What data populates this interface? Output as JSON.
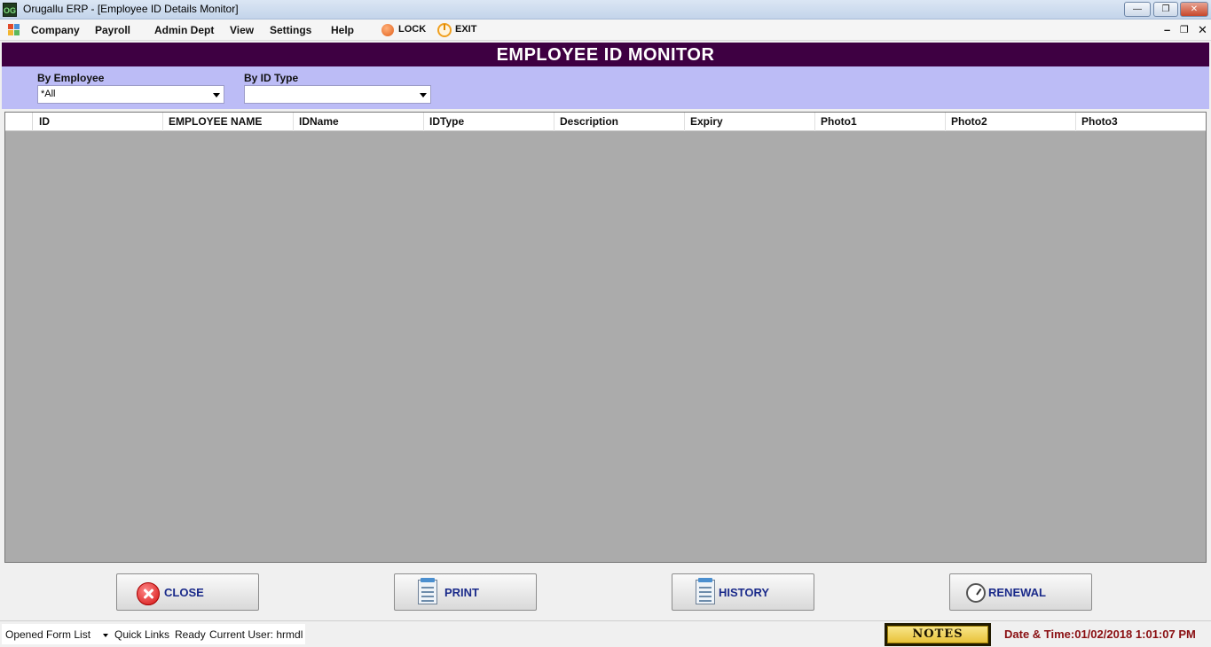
{
  "window": {
    "title": "Orugallu ERP - [Employee ID Details Monitor]",
    "app_icon_text": "OG"
  },
  "menu": {
    "items": [
      "Company",
      "Payroll",
      "Admin Dept",
      "View",
      "Settings",
      "Help"
    ],
    "lock_label": "LOCK",
    "exit_label": "EXIT"
  },
  "header": {
    "title": "EMPLOYEE ID MONITOR"
  },
  "filters": {
    "by_employee_label": "By Employee",
    "by_employee_value": "*All",
    "by_id_type_label": "By ID Type",
    "by_id_type_value": ""
  },
  "grid": {
    "columns": [
      "ID",
      "EMPLOYEE NAME",
      "IDName",
      "IDType",
      "Description",
      "Expiry",
      "Photo1",
      "Photo2",
      "Photo3"
    ]
  },
  "buttons": {
    "close": "CLOSE",
    "print": "PRINT",
    "history": "HISTORY",
    "renewal": "RENEWAL"
  },
  "status": {
    "opened_form_list": "Opened Form List",
    "quick_links": "Quick Links",
    "ready": "Ready",
    "current_user": "Current User: hrmdl",
    "notes": "NOTES",
    "datetime": "Date & Time:01/02/2018 1:01:07 PM"
  },
  "colors": {
    "header_band": "#3e0042",
    "filter_panel": "#bcbcf6",
    "grid_background": "#ababab",
    "button_text": "#1a2a8a",
    "datetime_text": "#8a0f12"
  }
}
